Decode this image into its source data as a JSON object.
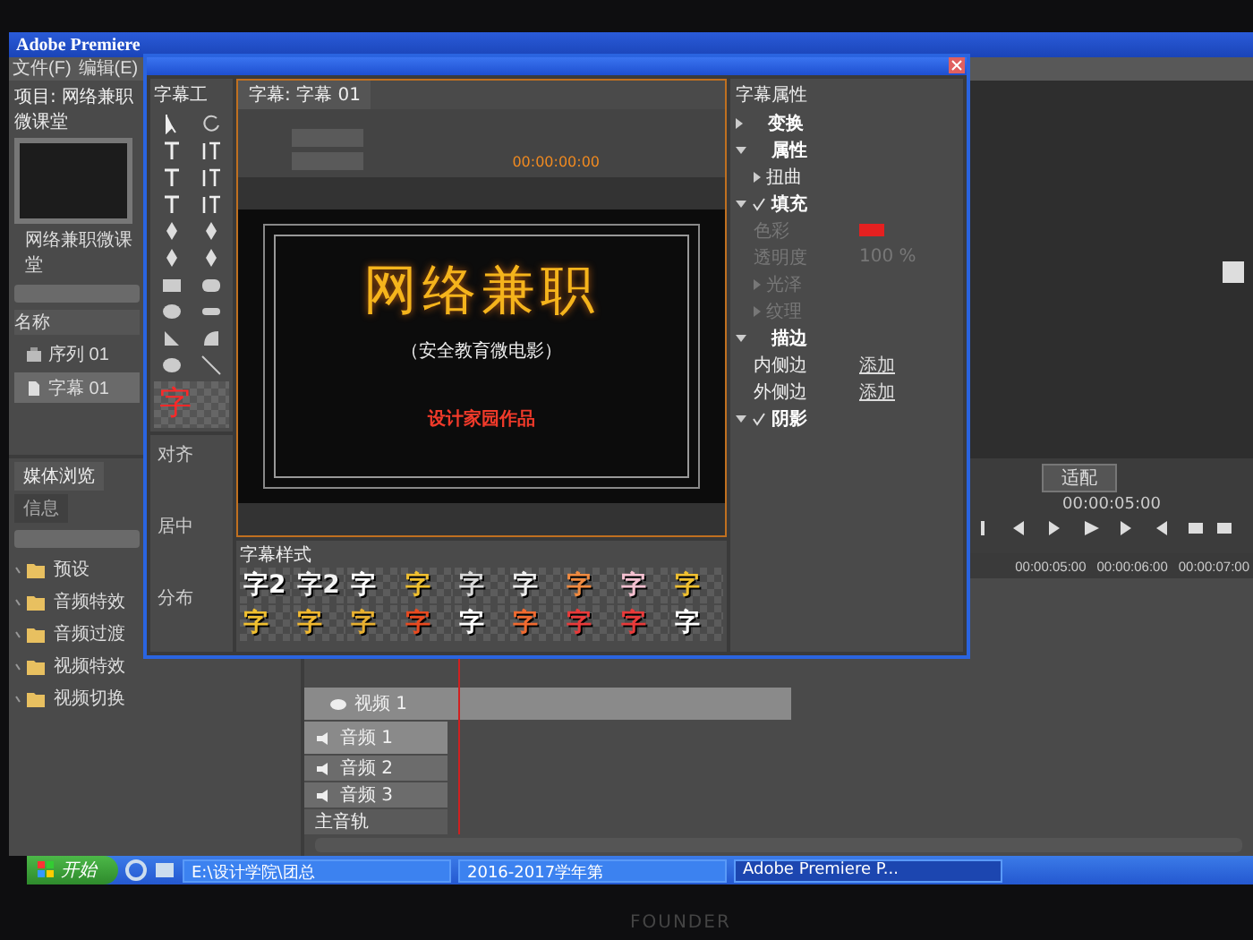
{
  "app_window": {
    "title": "Adobe Premiere",
    "menu": [
      "文件(F)",
      "编辑(E)"
    ]
  },
  "project_panel": {
    "title": "项目: 网络兼职微课堂",
    "project_file": "网络兼职微课堂",
    "column": "名称",
    "items": [
      {
        "kind": "sequence",
        "label": "序列 01",
        "selected": false
      },
      {
        "kind": "title",
        "label": "字幕 01",
        "selected": true
      }
    ]
  },
  "effects_panel": {
    "tabs": [
      {
        "label": "媒体浏览",
        "selected": true
      },
      {
        "label": "信息",
        "selected": false
      }
    ],
    "folders": [
      "预设",
      "音频特效",
      "音频过渡",
      "视频特效",
      "视频切换"
    ]
  },
  "program_monitor": {
    "fit": "适配",
    "timecode": "00:00:05:00",
    "ruler": [
      "00:00:05:00",
      "00:00:06:00",
      "00:00:07:00"
    ]
  },
  "timeline": {
    "tracks": [
      {
        "kind": "video",
        "label": "视频 1"
      },
      {
        "kind": "audio",
        "label": "音频 1"
      },
      {
        "kind": "audio",
        "label": "音频 2"
      },
      {
        "kind": "audio",
        "label": "音频 3"
      },
      {
        "kind": "master",
        "label": "主音轨"
      }
    ]
  },
  "titler": {
    "tools_title": "字幕工",
    "tab": "字幕: 字幕 01",
    "timecode": "00:00:00:00",
    "preview_label": "字",
    "canvas": {
      "heading": "网络兼职",
      "subtitle": "（安全教育微电影）",
      "credit": "设计家园作品"
    },
    "actions": [
      "对齐",
      "居中",
      "分布"
    ],
    "styles_title": "字幕样式",
    "styles": [
      {
        "label": "字2",
        "color": "#ffffff"
      },
      {
        "label": "字2",
        "color": "#f2f2f2"
      },
      {
        "label": "字",
        "color": "#ffffff"
      },
      {
        "label": "字",
        "color": "#f0c030"
      },
      {
        "label": "字",
        "color": "#d8d8d8"
      },
      {
        "label": "字",
        "color": "#eeeeee"
      },
      {
        "label": "字",
        "color": "#f08a40"
      },
      {
        "label": "字",
        "color": "#f4c0d0"
      },
      {
        "label": "字",
        "color": "#f0c030"
      },
      {
        "label": "字",
        "color": "#f0c030"
      },
      {
        "label": "字",
        "color": "#f0b830"
      },
      {
        "label": "字",
        "color": "#e8b030"
      },
      {
        "label": "字",
        "color": "#e84a20"
      },
      {
        "label": "字",
        "color": "#ffffff"
      },
      {
        "label": "字",
        "color": "#f06a30"
      },
      {
        "label": "字",
        "color": "#e83a3a"
      },
      {
        "label": "字",
        "color": "#e83a3a"
      },
      {
        "label": "字",
        "color": "#ffffff"
      }
    ],
    "properties_title": "字幕属性",
    "properties": [
      {
        "label": "变换",
        "expanded": false,
        "checked": false
      },
      {
        "label": "属性",
        "expanded": true,
        "checked": false,
        "children": [
          {
            "kind": "group",
            "label": "扭曲",
            "disabled": false
          }
        ]
      },
      {
        "label": "填充",
        "expanded": true,
        "checked": true,
        "children": [
          {
            "kind": "color",
            "label": "色彩",
            "color": "#e52020",
            "disabled": true
          },
          {
            "kind": "value",
            "label": "透明度",
            "value": "100 %",
            "disabled": true
          },
          {
            "kind": "group",
            "label": "光泽",
            "disabled": true
          },
          {
            "kind": "group",
            "label": "纹理",
            "disabled": true
          }
        ]
      },
      {
        "label": "描边",
        "expanded": true,
        "checked": false,
        "children": [
          {
            "kind": "link",
            "label": "内侧边",
            "link": "添加",
            "disabled": false
          },
          {
            "kind": "link",
            "label": "外侧边",
            "link": "添加",
            "disabled": false
          }
        ]
      },
      {
        "label": "阴影",
        "expanded": true,
        "checked": true
      }
    ]
  },
  "taskbar": {
    "start": "开始",
    "tasks": [
      {
        "label": "E:\\设计学院\\团总",
        "selected": false
      },
      {
        "label": "2016-2017学年第",
        "selected": false
      },
      {
        "label": "Adobe Premiere P...",
        "selected": true
      }
    ]
  },
  "bezel": {
    "brand": "FOUNDER"
  }
}
